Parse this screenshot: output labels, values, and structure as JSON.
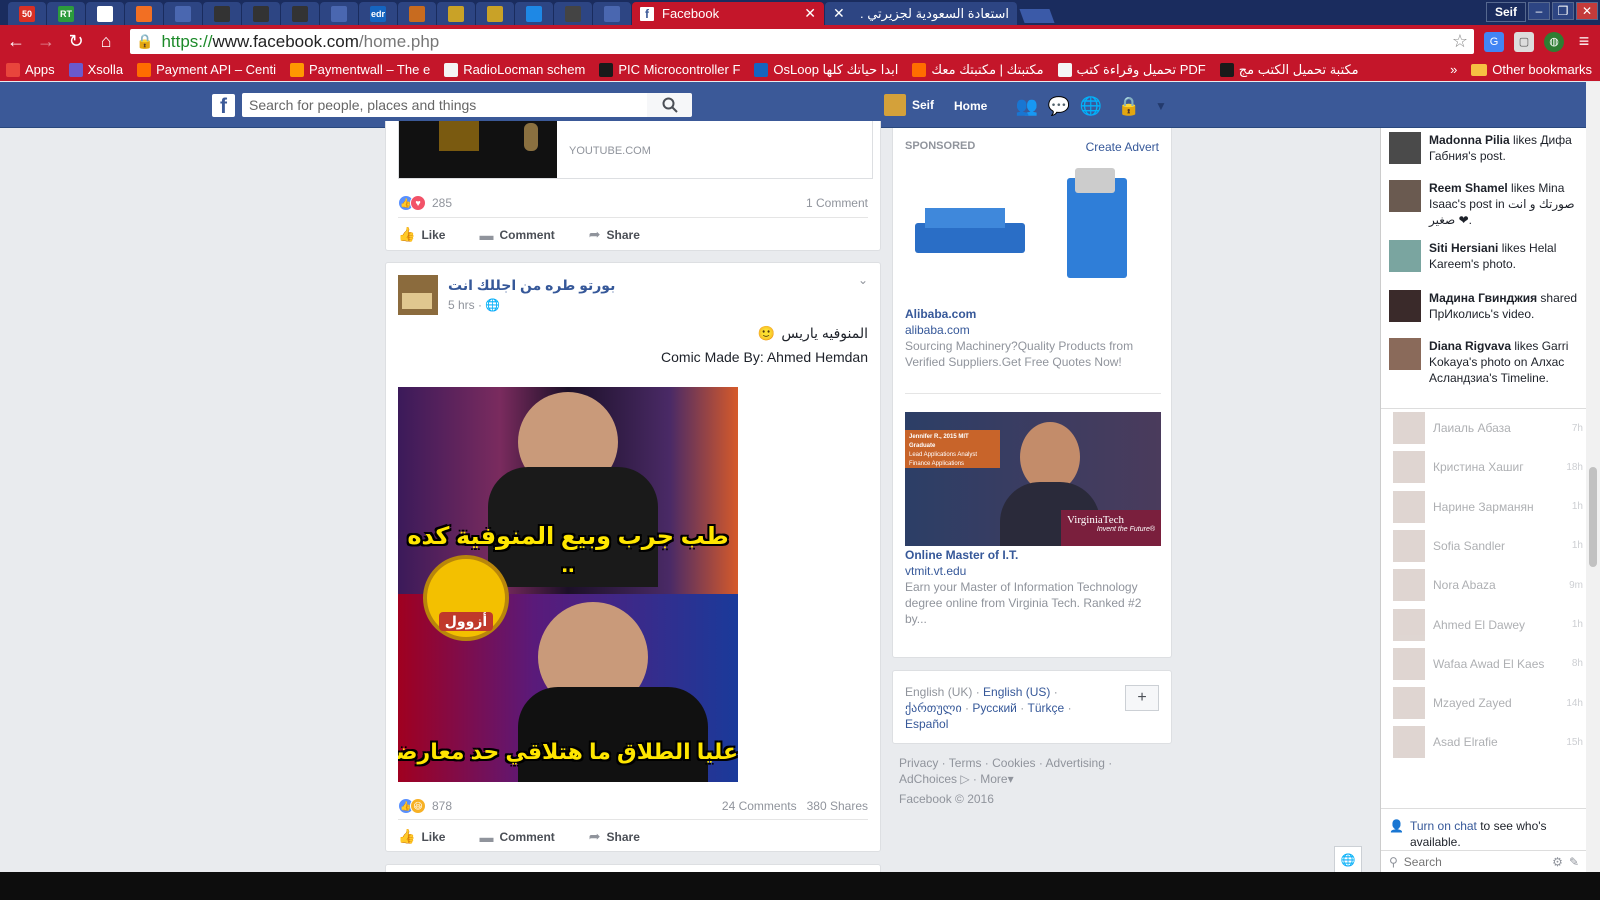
{
  "browser": {
    "tabs_pinned": [
      {
        "label": "50",
        "icon": "gmail-count-icon",
        "color": "#d93025"
      },
      {
        "label": "RT",
        "icon": "rt-icon",
        "color": "#2c9b3c"
      },
      {
        "label": "",
        "icon": "flag-icon",
        "color": "#ffffff"
      },
      {
        "label": "",
        "icon": "soundcloud-icon",
        "color": "#f26f23"
      },
      {
        "label": "",
        "icon": "opera-icon",
        "color": "#4a67b0"
      },
      {
        "label": "",
        "icon": "github-icon",
        "color": "#333333"
      },
      {
        "label": "",
        "icon": "github-icon",
        "color": "#333333"
      },
      {
        "label": "",
        "icon": "github-icon",
        "color": "#333333"
      },
      {
        "label": "",
        "icon": "page-icon",
        "color": "#4a67b0"
      },
      {
        "label": "edr",
        "icon": "edr-icon",
        "color": "#1565c0"
      },
      {
        "label": "",
        "icon": "stack-icon",
        "color": "#c86b1f"
      },
      {
        "label": "",
        "icon": "badge-icon",
        "color": "#c9a227"
      },
      {
        "label": "",
        "icon": "badge-icon",
        "color": "#c9a227"
      },
      {
        "label": "",
        "icon": "windows-icon",
        "color": "#1e88e5"
      },
      {
        "label": "",
        "icon": "image-icon",
        "color": "#444444"
      },
      {
        "label": "",
        "icon": "page-icon",
        "color": "#4a67b0"
      }
    ],
    "active_tab": "Facebook",
    "other_tab": "استعادة السعودية لجزيرتي .",
    "profile_button": "Seif",
    "url_scheme": "https://",
    "url_host": "www.facebook.com",
    "url_path": "/home.php",
    "bookmarks": [
      {
        "label": "Apps",
        "color": "#e8453c"
      },
      {
        "label": "Xsolla",
        "color": "#6a5acd"
      },
      {
        "label": "Payment API – Centi",
        "color": "#ff6d00"
      },
      {
        "label": "Paymentwall – The e",
        "color": "#ff9800"
      },
      {
        "label": "RadioLocman schem",
        "color": "#f4f4f4"
      },
      {
        "label": "PIC Microcontroller F",
        "color": "#1a1a1a"
      },
      {
        "label": "OsLoop ابدا حياتك كلها",
        "color": "#1565c0"
      },
      {
        "label": "مكتبتك | مكتبتك معك",
        "color": "#ff6d00"
      },
      {
        "label": "تحميل وقراءة كتب PDF",
        "color": "#f4f4f4"
      },
      {
        "label": "مكتبة تحميل الكتب مج",
        "color": "#1a1a1a"
      }
    ],
    "bookmarks_overflow": "»",
    "other_bookmarks": "Other bookmarks"
  },
  "fb": {
    "logo": "f",
    "search_placeholder": "Search for people, places and things",
    "user_name": "Seif",
    "home_label": "Home"
  },
  "post1": {
    "link_domain": "YOUTUBE.COM",
    "reactions": "285",
    "comments": "1 Comment",
    "like": "Like",
    "comment": "Comment",
    "share": "Share"
  },
  "post2": {
    "author": "بورتو طره من اجللك انت",
    "time": "5 hrs · ",
    "line1": "المنوفيه ياريس",
    "line2": "Comic Made By: Ahmed Hemdan",
    "meme_top": "طب جرب وبيع المنوفية كده ..",
    "meme_bottom": "عليا الطلاق ما هتلاقي حد معارضك نهائي",
    "meme_logo": "أزوول",
    "reactions": "878",
    "comments": "24 Comments",
    "shares": "380 Shares",
    "like": "Like",
    "comment": "Comment",
    "share": "Share"
  },
  "ads": {
    "sponsored": "SPONSORED",
    "create_advert": "Create Advert",
    "ad1_title": "Alibaba.com",
    "ad1_url": "alibaba.com",
    "ad1_text": "Sourcing Machinery?Quality Products from Verified Suppliers.Get Free Quotes Now!",
    "ad2_banner_line1": "Jennifer R., 2015 MIT Graduate",
    "ad2_banner_line2": "Lead Applications Analyst",
    "ad2_banner_line3": "Finance Applications",
    "ad2_brand": "VirginiaTech",
    "ad2_tagline": "Invent the Future®",
    "ad2_title": "Online Master of I.T.",
    "ad2_url": "vtmit.vt.edu",
    "ad2_text": "Earn your Master of Information Technology degree online from Virginia Tech. Ranked #2 by..."
  },
  "languages": {
    "current": "English (UK)",
    "options": [
      "English (US)",
      "ქართული",
      "Русский",
      "Türkçe",
      "Español"
    ],
    "add": "+"
  },
  "footer": {
    "links": [
      "Privacy",
      "Terms",
      "Cookies",
      "Advertising",
      "AdChoices",
      "More"
    ],
    "copyright": "Facebook © 2016"
  },
  "ticker": [
    {
      "name": "Madonna Pilia",
      "rest": " likes Дифа Габния's post."
    },
    {
      "name": "Reem Shamel",
      "rest": " likes Mina Isaac's post in صورتك و انت صغير ❤."
    },
    {
      "name": "Siti Hersiani",
      "rest": " likes Helal Kareem's photo."
    },
    {
      "name": "Мадина Гвинджия",
      "rest": " shared ПрИколись's video."
    },
    {
      "name": "Diana Rigvava",
      "rest": " likes Garri Kokaya's photo on Алхас Асландзиа's Timeline."
    }
  ],
  "chat": [
    {
      "name": "Лаиаль Абаза",
      "time": "7h"
    },
    {
      "name": "Кристина Хашиг",
      "time": "18h"
    },
    {
      "name": "Нарине Зарманян",
      "time": "1h"
    },
    {
      "name": "Sofia Sandler",
      "time": "1h"
    },
    {
      "name": "Nora Abaza",
      "time": "9m"
    },
    {
      "name": "Ahmed El Dawey",
      "time": "1h"
    },
    {
      "name": "Wafaa Awad El Kaes",
      "time": "8h"
    },
    {
      "name": "Mzayed Zayed",
      "time": "14h"
    },
    {
      "name": "Asad Elrafie",
      "time": "15h"
    }
  ],
  "chat_footer": {
    "turn_on": "Turn on chat",
    "rest": " to see who's available.",
    "search_placeholder": "Search"
  }
}
